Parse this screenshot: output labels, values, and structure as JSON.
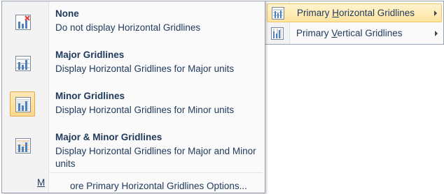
{
  "menu": {
    "items": [
      {
        "label_pre": "Primary ",
        "label_key": "H",
        "label_post": "orizontal Gridlines",
        "icon": "horizontal-gridlines-icon"
      },
      {
        "label_pre": "Primary ",
        "label_key": "V",
        "label_post": "ertical Gridlines",
        "icon": "vertical-gridlines-icon"
      }
    ]
  },
  "submenu": {
    "options": [
      {
        "title": "None",
        "desc": "Do not display Horizontal Gridlines",
        "icon": "no-gridlines-icon"
      },
      {
        "title": "Major Gridlines",
        "desc": "Display Horizontal Gridlines for Major units",
        "icon": "major-gridlines-icon"
      },
      {
        "title": "Minor Gridlines",
        "desc": "Display Horizontal Gridlines for Minor units",
        "icon": "minor-gridlines-icon"
      },
      {
        "title": "Major & Minor Gridlines",
        "desc": "Display Horizontal Gridlines for Major and Minor units",
        "icon": "major-minor-gridlines-icon"
      }
    ],
    "more_key": "M",
    "more_rest": "ore Primary Horizontal Gridlines Options..."
  },
  "colors": {
    "text": "#1e395b",
    "hover_bg": "#fde4a0",
    "selected_border": "#e8a94a",
    "bar_blue": "#4f81bd",
    "bar_orange": "#f79646",
    "red_x": "#e03c31"
  }
}
